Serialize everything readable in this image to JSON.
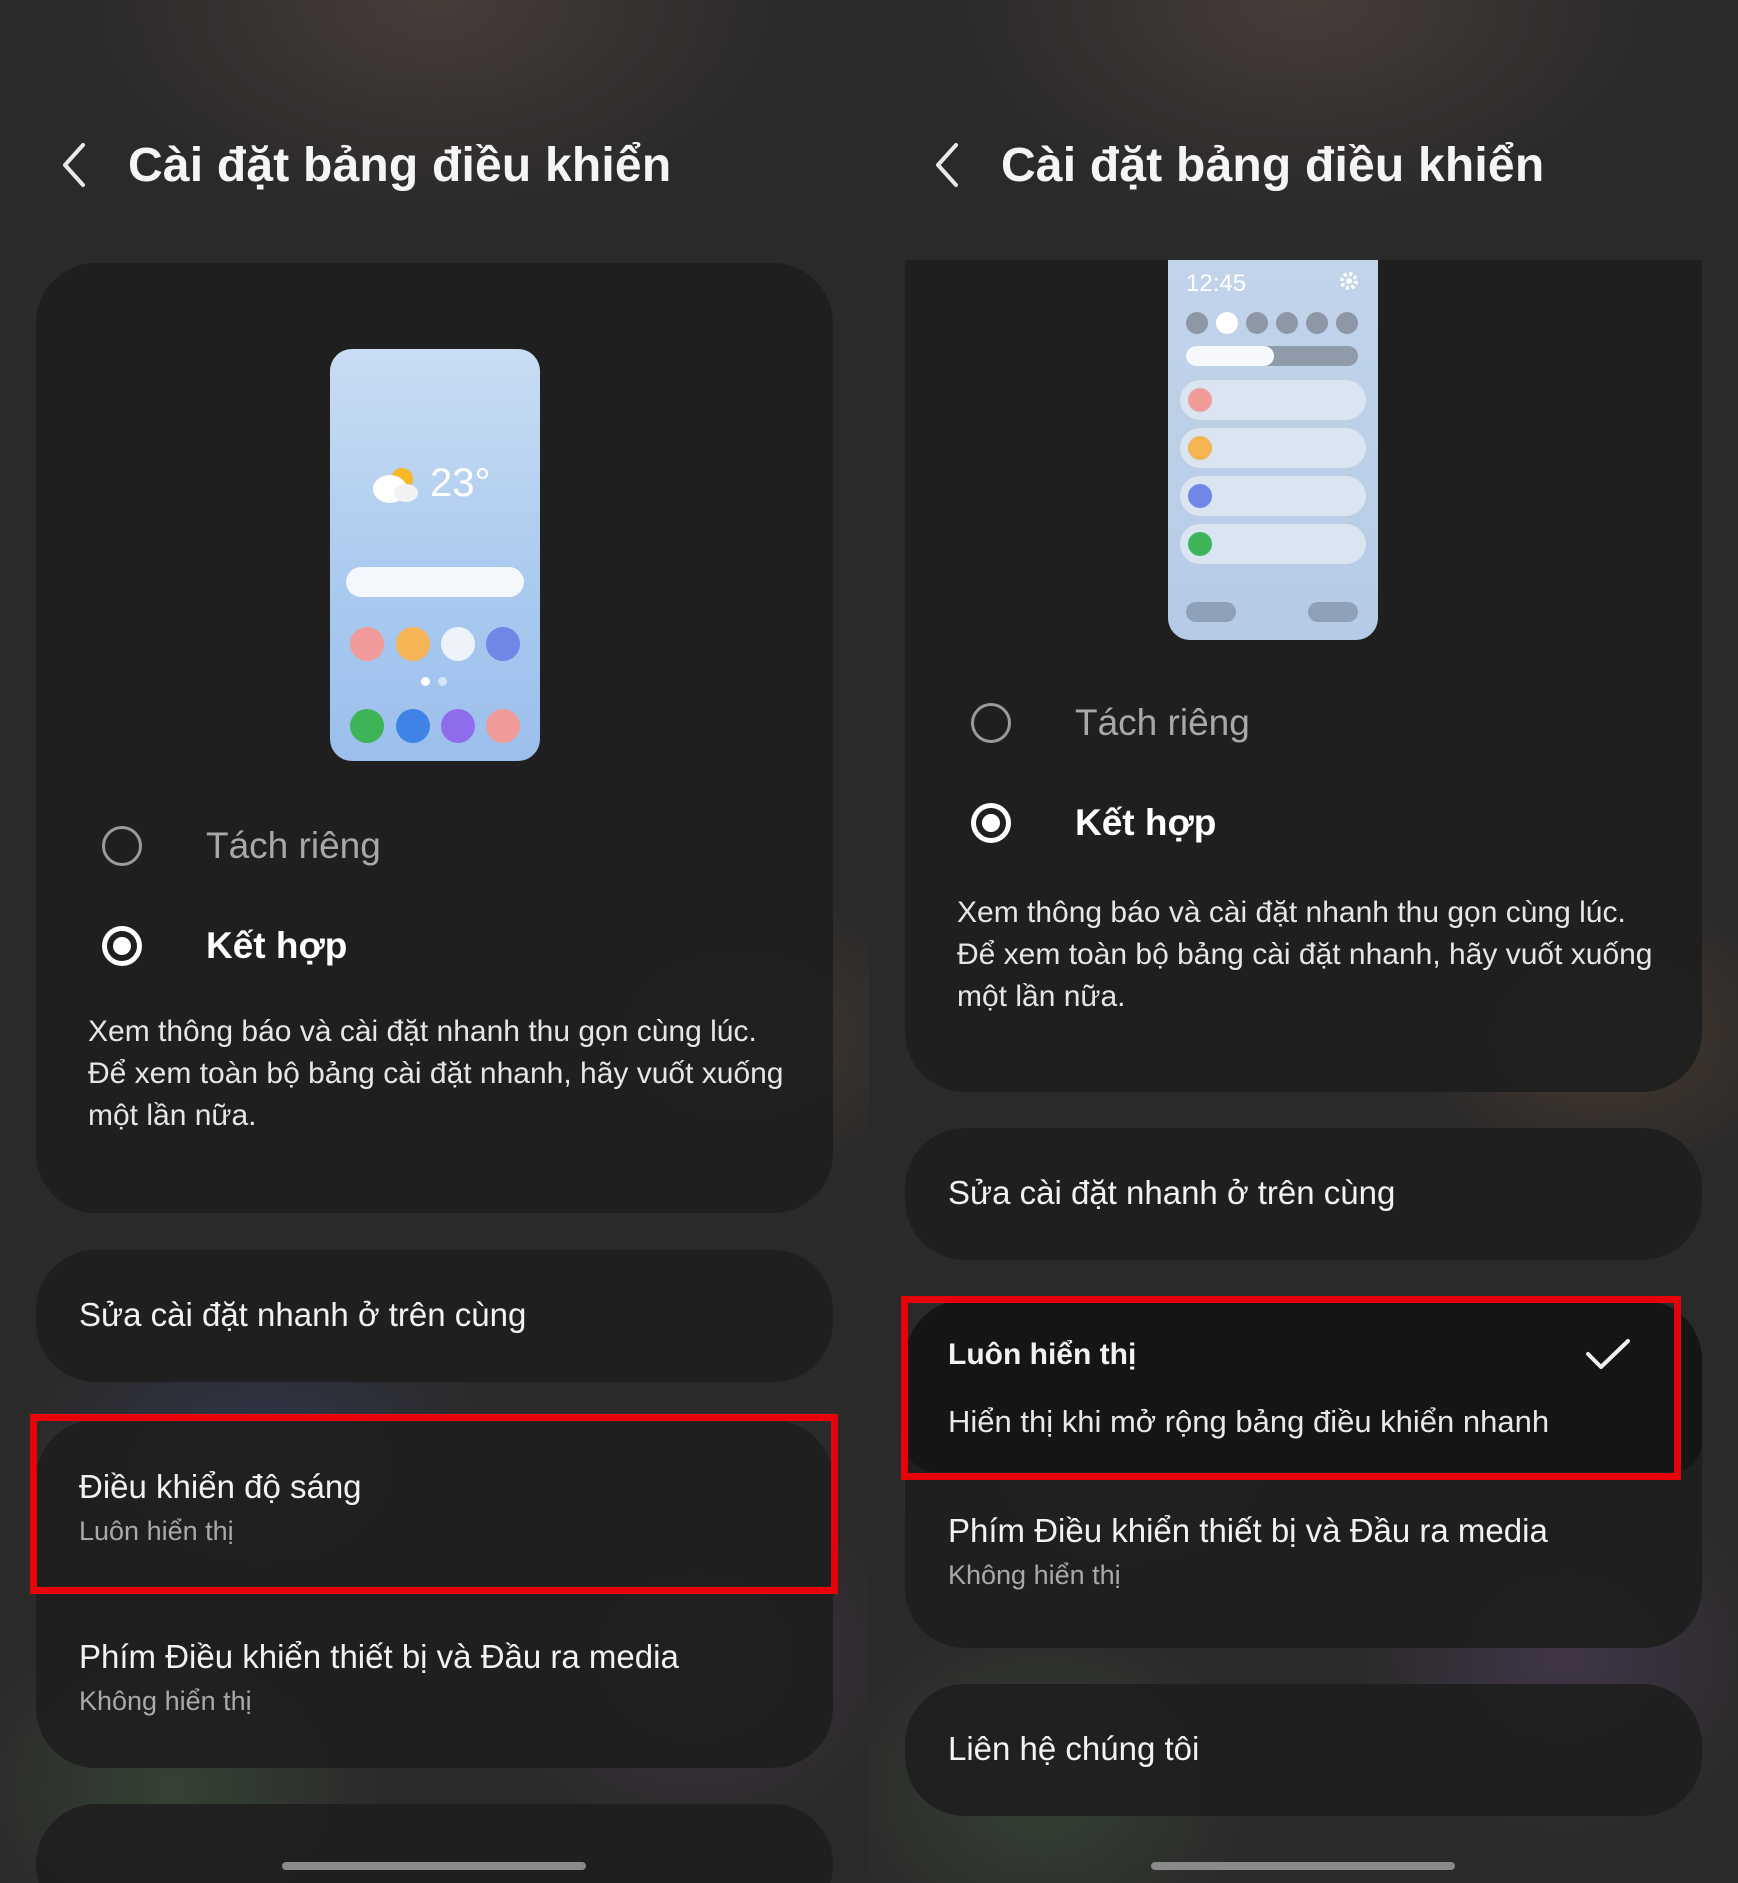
{
  "title": "Cài đặt bảng điều khiển",
  "left": {
    "preview": {
      "temperature": "23°"
    },
    "options": [
      {
        "label": "Tách riêng",
        "selected": false
      },
      {
        "label": "Kết hợp",
        "selected": true
      }
    ],
    "description": "Xem thông báo và cài đặt nhanh thu gọn cùng lúc. Để xem toàn bộ bảng cài đặt nhanh, hãy vuốt xuống một lần nữa.",
    "items": [
      {
        "title": "Sửa cài đặt nhanh ở trên cùng"
      },
      {
        "title": "Điều khiển độ sáng",
        "subtitle": "Luôn hiển thị"
      },
      {
        "title": "Phím Điều khiển thiết bị và Đầu ra media",
        "subtitle": "Không hiển thị"
      }
    ]
  },
  "right": {
    "preview": {
      "time": "12:45"
    },
    "options": [
      {
        "label": "Tách riêng",
        "selected": false
      },
      {
        "label": "Kết hợp",
        "selected": true
      }
    ],
    "description": "Xem thông báo và cài đặt nhanh thu gọn cùng lúc. Để xem toàn bộ bảng cài đặt nhanh, hãy vuốt xuống một lần nữa.",
    "items": [
      {
        "title": "Sửa cài đặt nhanh ở trên cùng"
      },
      {
        "title": "Luôn hiển thị",
        "subtitle": "Hiển thị khi mở rộng bảng điều khiển nhanh",
        "checked": true
      },
      {
        "title": "Phím Điều khiển thiết bị và Đầu ra media",
        "subtitle": "Không hiển thị"
      },
      {
        "title": "Liên hệ chúng tôi"
      }
    ]
  },
  "colors": {
    "highlight": "#e8000a",
    "card": "#1e1e1e",
    "background": "#2b2a2a"
  },
  "icons": [
    "back-icon",
    "weather-icon",
    "gear-icon",
    "check-icon"
  ]
}
